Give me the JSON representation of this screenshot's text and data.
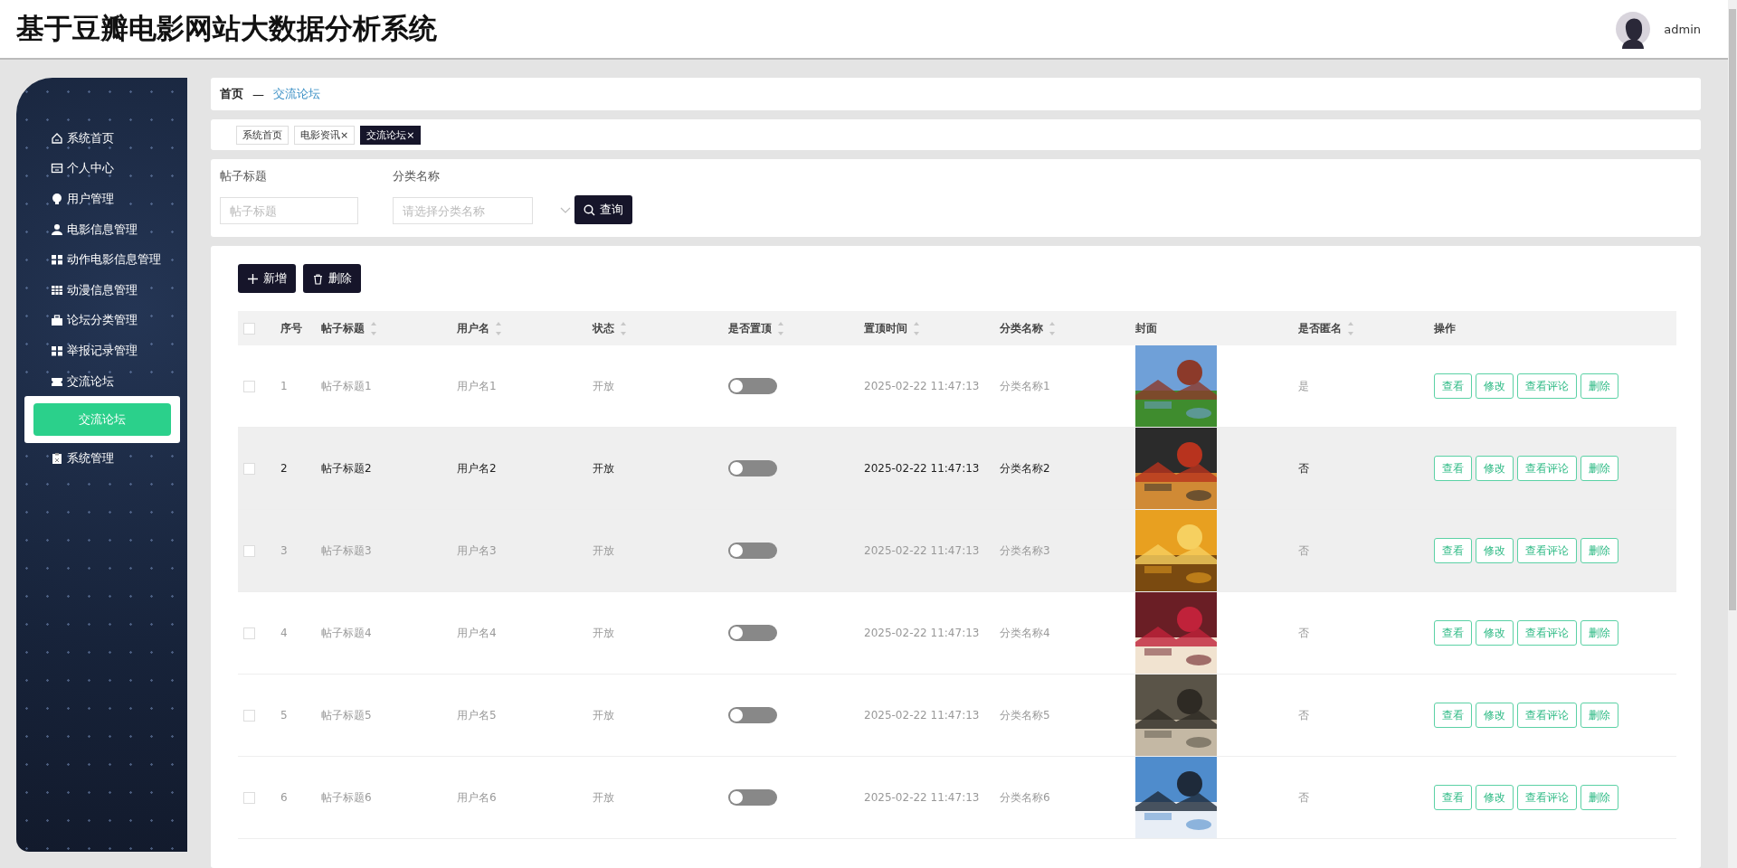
{
  "header": {
    "title": "基于豆瓣电影网站大数据分析系统",
    "user": "admin"
  },
  "sidebar": {
    "items": [
      {
        "label": "系统首页"
      },
      {
        "label": "个人中心"
      },
      {
        "label": "用户管理"
      },
      {
        "label": "电影信息管理"
      },
      {
        "label": "动作电影信息管理"
      },
      {
        "label": "动漫信息管理"
      },
      {
        "label": "论坛分类管理"
      },
      {
        "label": "举报记录管理"
      },
      {
        "label": "交流论坛",
        "children": [
          {
            "label": "交流论坛",
            "selected": true
          }
        ]
      },
      {
        "label": "系统管理"
      }
    ]
  },
  "breadcrumb": {
    "home": "首页",
    "separator": "—",
    "current": "交流论坛"
  },
  "tabs": [
    {
      "label": "系统首页",
      "selected": false
    },
    {
      "label": "电影资讯",
      "close": "×",
      "selected": false
    },
    {
      "label": "交流论坛",
      "close": "×",
      "selected": true
    }
  ],
  "search": {
    "fields": [
      {
        "label": "帖子标题",
        "placeholder": "帖子标题",
        "kind": "text"
      },
      {
        "label": "分类名称",
        "placeholder": "请选择分类名称",
        "kind": "select"
      }
    ],
    "button": "查询"
  },
  "toolbar": {
    "add": "新增",
    "delete": "删除"
  },
  "table": {
    "all_checked": false,
    "columns": [
      {
        "label": "序号",
        "sortable": false
      },
      {
        "label": "帖子标题",
        "sortable": true
      },
      {
        "label": "用户名",
        "sortable": true
      },
      {
        "label": "状态",
        "sortable": true
      },
      {
        "label": "是否置顶",
        "sortable": true
      },
      {
        "label": "置顶时间",
        "sortable": true
      },
      {
        "label": "分类名称",
        "sortable": true
      },
      {
        "label": "封面",
        "sortable": false
      },
      {
        "label": "是否匿名",
        "sortable": true
      },
      {
        "label": "操作",
        "sortable": false
      }
    ],
    "rows": [
      {
        "checked": false,
        "index": "1",
        "title": "帖子标题1",
        "user": "用户名1",
        "status": "开放",
        "pinned": false,
        "time": "2025-02-22 11:47:13",
        "category": "分类名称1",
        "anonymous": "是",
        "hovered": false,
        "highlighted": false,
        "actions": [
          "查看",
          "修改",
          "查看评论",
          "删除"
        ]
      },
      {
        "checked": false,
        "index": "2",
        "title": "帖子标题2",
        "user": "用户名2",
        "status": "开放",
        "pinned": false,
        "time": "2025-02-22 11:47:13",
        "category": "分类名称2",
        "anonymous": "否",
        "hovered": true,
        "highlighted": true,
        "actions": [
          "查看",
          "修改",
          "查看评论",
          "删除"
        ]
      },
      {
        "checked": false,
        "index": "3",
        "title": "帖子标题3",
        "user": "用户名3",
        "status": "开放",
        "pinned": false,
        "time": "2025-02-22 11:47:13",
        "category": "分类名称3",
        "anonymous": "否",
        "hovered": false,
        "highlighted": true,
        "actions": [
          "查看",
          "修改",
          "查看评论",
          "删除"
        ]
      },
      {
        "checked": false,
        "index": "4",
        "title": "帖子标题4",
        "user": "用户名4",
        "status": "开放",
        "pinned": false,
        "time": "2025-02-22 11:47:13",
        "category": "分类名称4",
        "anonymous": "否",
        "hovered": false,
        "highlighted": false,
        "actions": [
          "查看",
          "修改",
          "查看评论",
          "删除"
        ]
      },
      {
        "checked": false,
        "index": "5",
        "title": "帖子标题5",
        "user": "用户名5",
        "status": "开放",
        "pinned": false,
        "time": "2025-02-22 11:47:13",
        "category": "分类名称5",
        "anonymous": "否",
        "hovered": false,
        "highlighted": false,
        "actions": [
          "查看",
          "修改",
          "查看评论",
          "删除"
        ]
      },
      {
        "checked": false,
        "index": "6",
        "title": "帖子标题6",
        "user": "用户名6",
        "status": "开放",
        "pinned": false,
        "time": "2025-02-22 11:47:13",
        "category": "分类名称6",
        "anonymous": "否",
        "hovered": false,
        "highlighted": false,
        "actions": [
          "查看",
          "修改",
          "查看评论",
          "删除"
        ]
      }
    ]
  }
}
